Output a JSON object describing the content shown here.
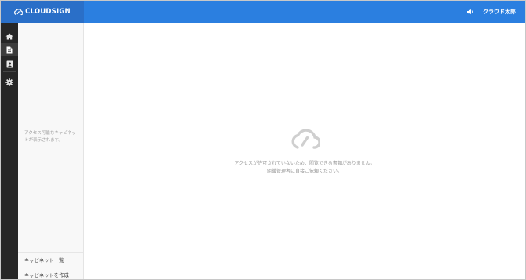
{
  "header": {
    "logo_text": "CLOUDSIGN",
    "user_name": "クラウド太郎",
    "colors": {
      "bar": "#2b7fe0",
      "logo_box": "#2a6fc8"
    }
  },
  "rail": {
    "items": [
      {
        "icon": "home-icon"
      },
      {
        "icon": "document-icon",
        "active": true
      },
      {
        "icon": "contact-card-icon"
      },
      {
        "icon": "gear-icon"
      }
    ]
  },
  "panel": {
    "empty_text_line1": "アクセス可能なキャビネッ",
    "empty_text_line2": "トが表示されます。",
    "footer_items": [
      {
        "label": "キャビネット一覧"
      },
      {
        "label": "キャビネットを作成"
      }
    ]
  },
  "main": {
    "empty_icon": "cloudsign-cloud-icon",
    "message_line1": "アクセスが許可されていないため、閲覧できる書類がありません。",
    "message_line2": "組織管理者に直接ご依頼ください。"
  }
}
